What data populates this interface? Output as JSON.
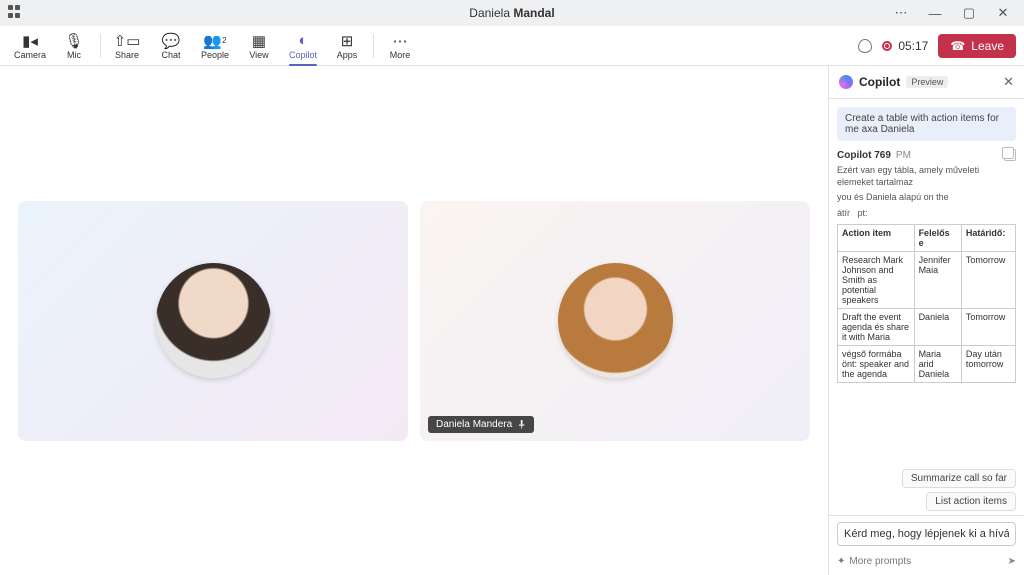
{
  "titlebar": {
    "first": "Daniela",
    "last": "Mandal"
  },
  "toolbar": {
    "camera": "Camera",
    "mic": "Mic",
    "share": "Share",
    "chat": "Chat",
    "people": "People",
    "people_count": "2",
    "view": "View",
    "copilot": "Copilot",
    "apps": "Apps",
    "more": "More"
  },
  "call": {
    "timer": "05:17",
    "leave": "Leave"
  },
  "tiles": {
    "participant_name": "Daniela Mandera"
  },
  "copilot": {
    "title": "Copilot",
    "badge": "Preview",
    "user_msg": "Create a table with action items for me axa Daniela",
    "sender": "Copilot 769",
    "time": "PM",
    "desc1": "Ezért van egy tábla, amely műveleti elemeket tartalmaz",
    "desc2a": "you",
    "desc2b": "és Daniela alapú",
    "desc2c": "on the",
    "desc3a": "átír",
    "desc3b": "pt:",
    "headers": {
      "c1": "Action item",
      "c2": "Felelős e",
      "c3": "Határidő:"
    },
    "rows": [
      {
        "a": "Research Mark Johnson and Smith as potential speakers",
        "b": "Jennifer Maia",
        "c": "Tomorrow"
      },
      {
        "a": "Draft the event agenda és share it with Maria",
        "b": "Daniela",
        "c": "Tomorrow"
      },
      {
        "a": "végső formába önt: speaker and the agenda",
        "b": "Maria arid Daniela",
        "c": "Day után tomorrow"
      }
    ],
    "chips": {
      "summarize": "Summarize call so far",
      "list": "List action items"
    },
    "input": "Kérd meg, hogy lépjenek ki a hívásból",
    "more_prompts": "More prompts"
  }
}
